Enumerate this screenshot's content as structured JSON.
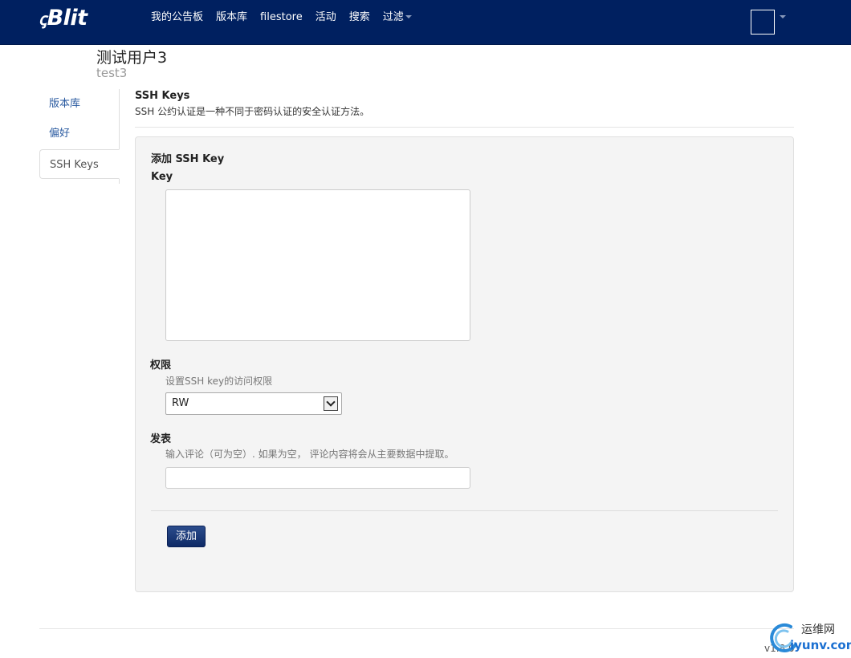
{
  "navbar": {
    "brand": "Blit",
    "brand_mark": "ꞔ",
    "links": [
      {
        "label": "我的公告板"
      },
      {
        "label": "版本库"
      },
      {
        "label": "filestore"
      },
      {
        "label": "活动"
      },
      {
        "label": "搜索"
      },
      {
        "label": "过滤"
      }
    ]
  },
  "user": {
    "display_name": "测试用户3",
    "username": "test3"
  },
  "side_tabs": [
    {
      "label": "版本库",
      "active": false
    },
    {
      "label": "偏好",
      "active": false
    },
    {
      "label": "SSH Keys",
      "active": true
    }
  ],
  "section": {
    "title": "SSH Keys",
    "description": "SSH 公约认证是一种不同于密码认证的安全认证方法。"
  },
  "form": {
    "legend": "添加 SSH Key",
    "key_label": "Key",
    "key_value": "",
    "permission_label": "权限",
    "permission_help": "设置SSH key的访问权限",
    "permission_value": "RW",
    "comment_label": "发表",
    "comment_help": "输入评论（可为空）. 如果为空， 评论内容将会从主要数据中提取。",
    "comment_value": "",
    "submit_label": "添加"
  },
  "footer": {
    "version": "v1.8.0"
  },
  "watermark": {
    "cn": "运维网",
    "en": "iyunv.com"
  },
  "colors": {
    "navbar": "#002060",
    "link": "#2a5aa0",
    "button": "#1a3a7a"
  }
}
